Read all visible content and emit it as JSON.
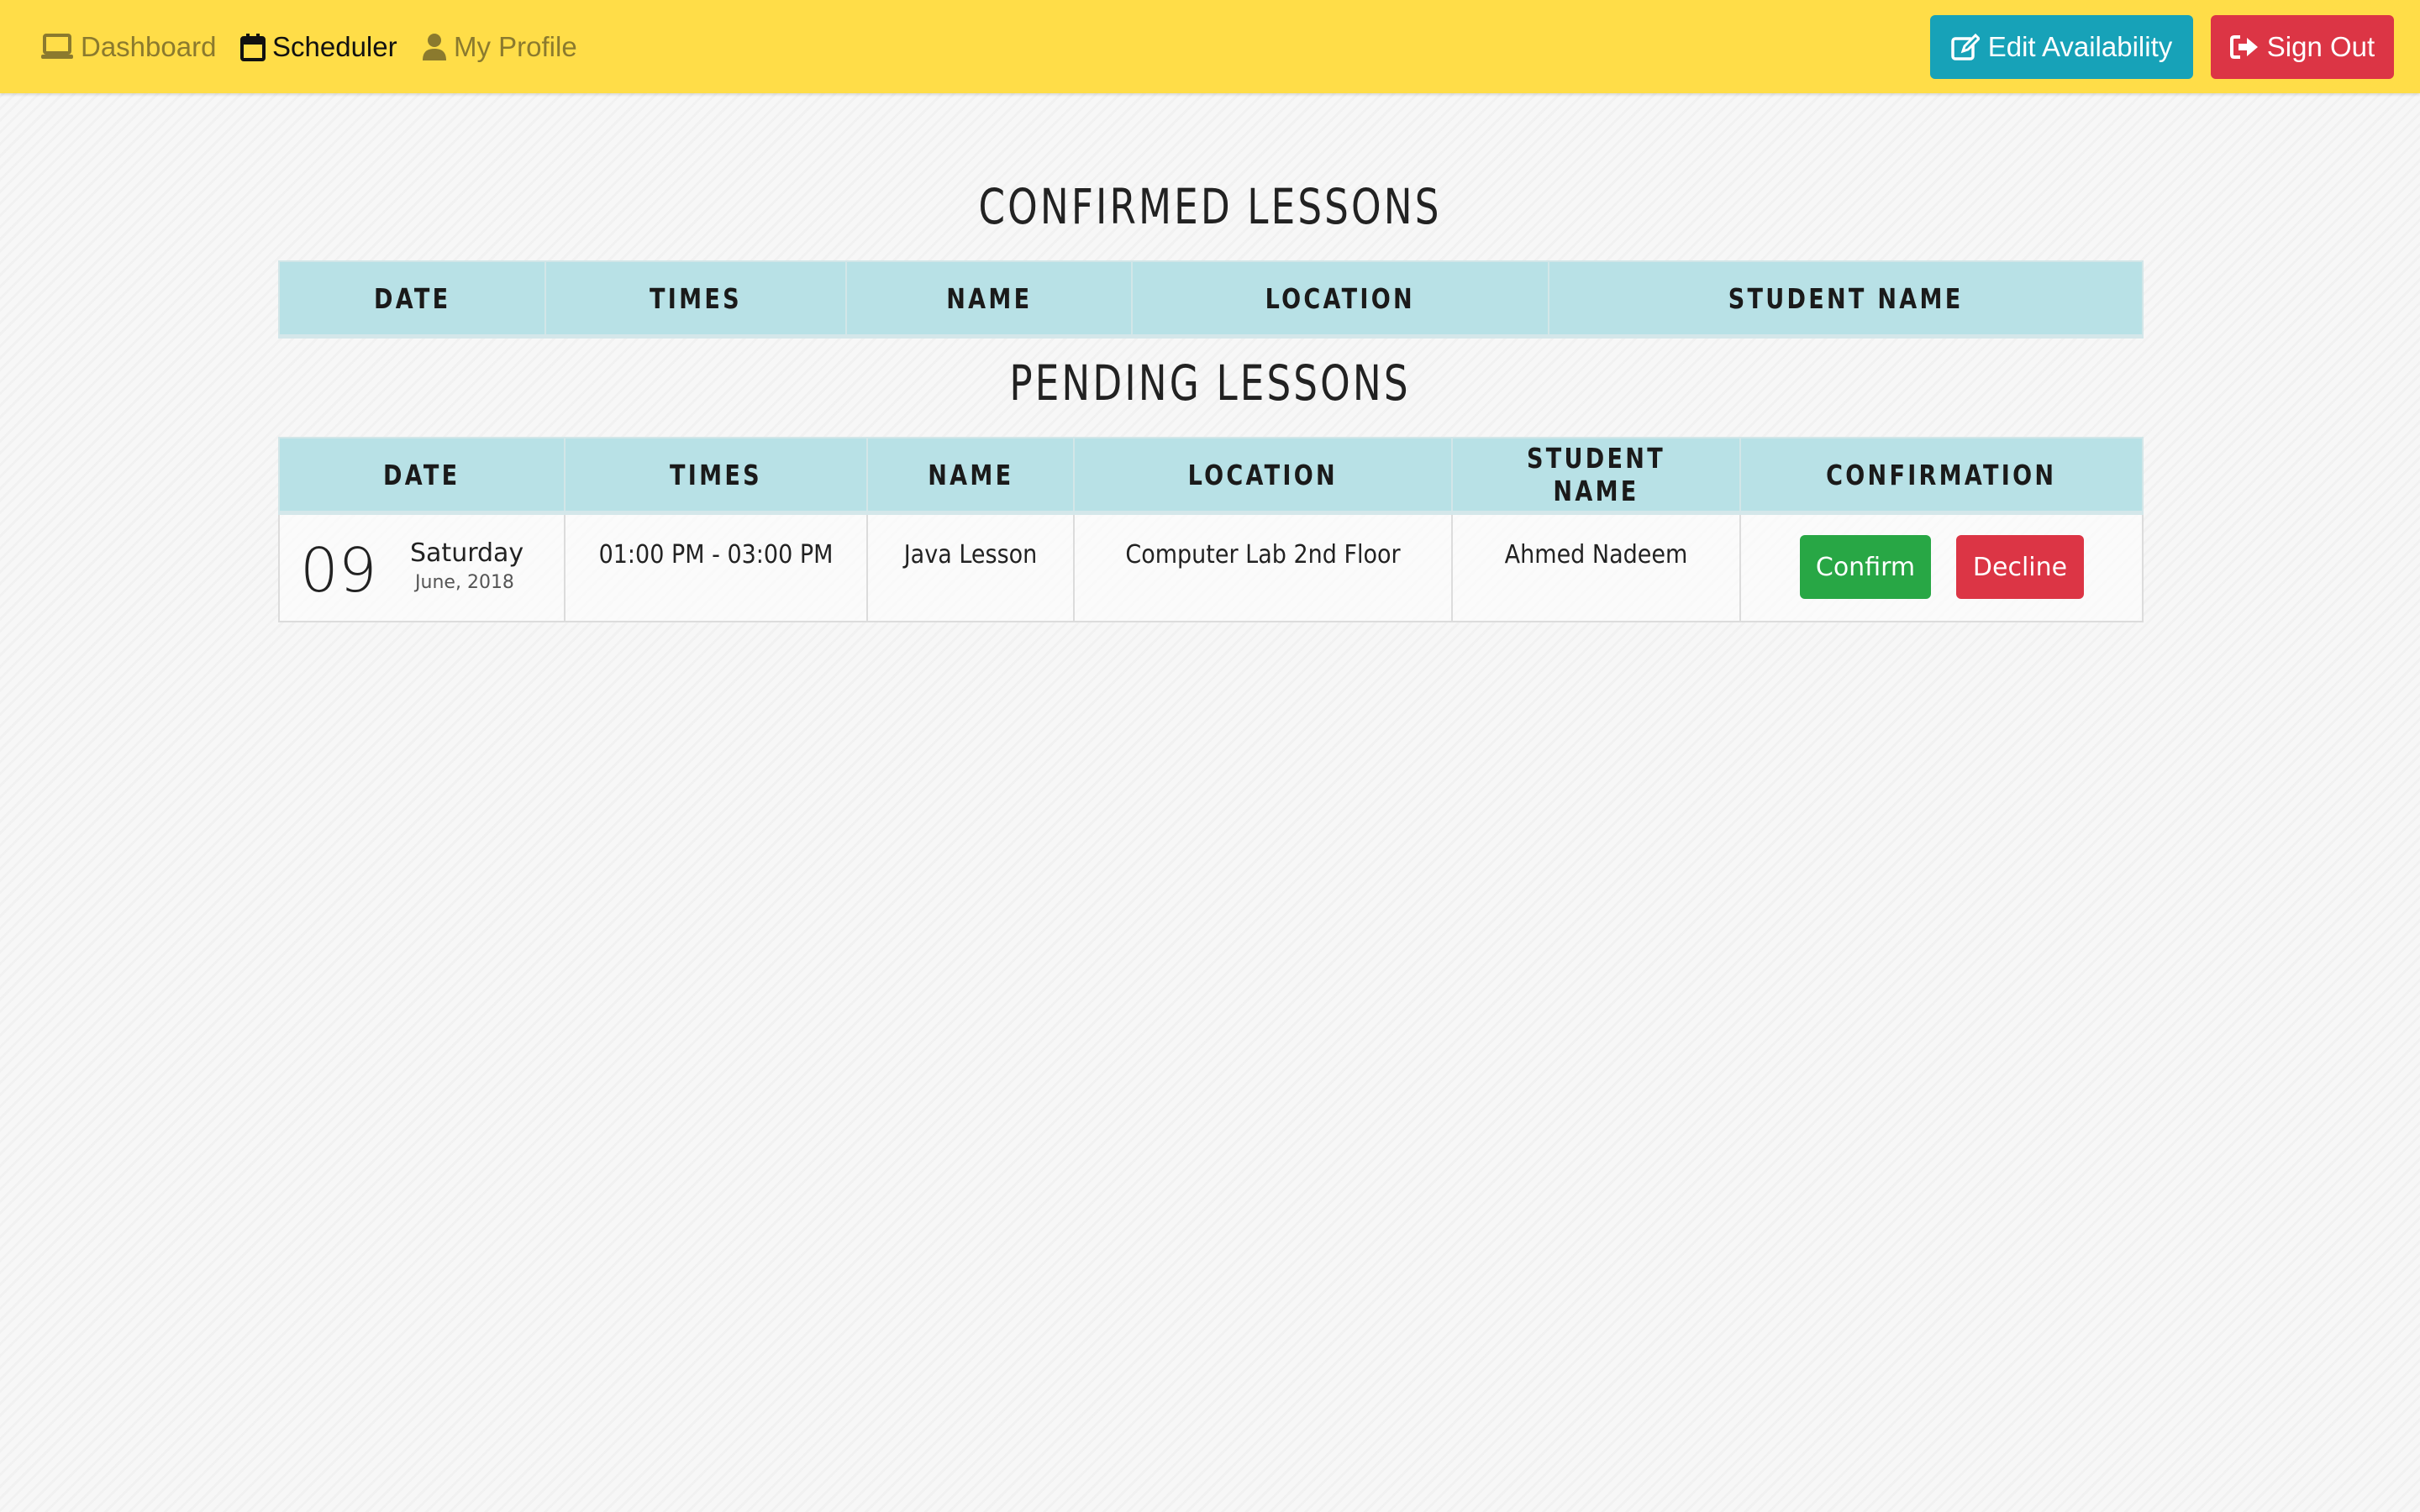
{
  "nav": {
    "dashboard": {
      "label": "Dashboard",
      "icon": "laptop-icon"
    },
    "scheduler": {
      "label": "Scheduler",
      "icon": "calendar-icon"
    },
    "profile": {
      "label": "My Profile",
      "icon": "user-icon"
    },
    "edit_availability": {
      "label": "Edit Availability",
      "icon": "edit-icon"
    },
    "sign_out": {
      "label": "Sign Out",
      "icon": "sign-out-icon"
    }
  },
  "confirmed": {
    "title": "CONFIRMED LESSONS",
    "headers": [
      "DATE",
      "TIMES",
      "NAME",
      "LOCATION",
      "STUDENT NAME"
    ],
    "rows": []
  },
  "pending": {
    "title": "PENDING LESSONS",
    "headers": [
      "DATE",
      "TIMES",
      "NAME",
      "LOCATION",
      "STUDENT NAME",
      "CONFIRMATION"
    ],
    "rows": [
      {
        "day": "09",
        "weekday": "Saturday",
        "month_year": "June, 2018",
        "times": "01:00 PM - 03:00 PM",
        "name": "Java Lesson",
        "location": "Computer Lab 2nd Floor",
        "student": "Ahmed Nadeem",
        "confirm_label": "Confirm",
        "decline_label": "Decline"
      }
    ]
  },
  "colors": {
    "navbar": "#ffdd48",
    "info": "#17a2b8",
    "danger": "#dc3545",
    "success": "#28a745",
    "table_header": "#b8e1e6"
  }
}
